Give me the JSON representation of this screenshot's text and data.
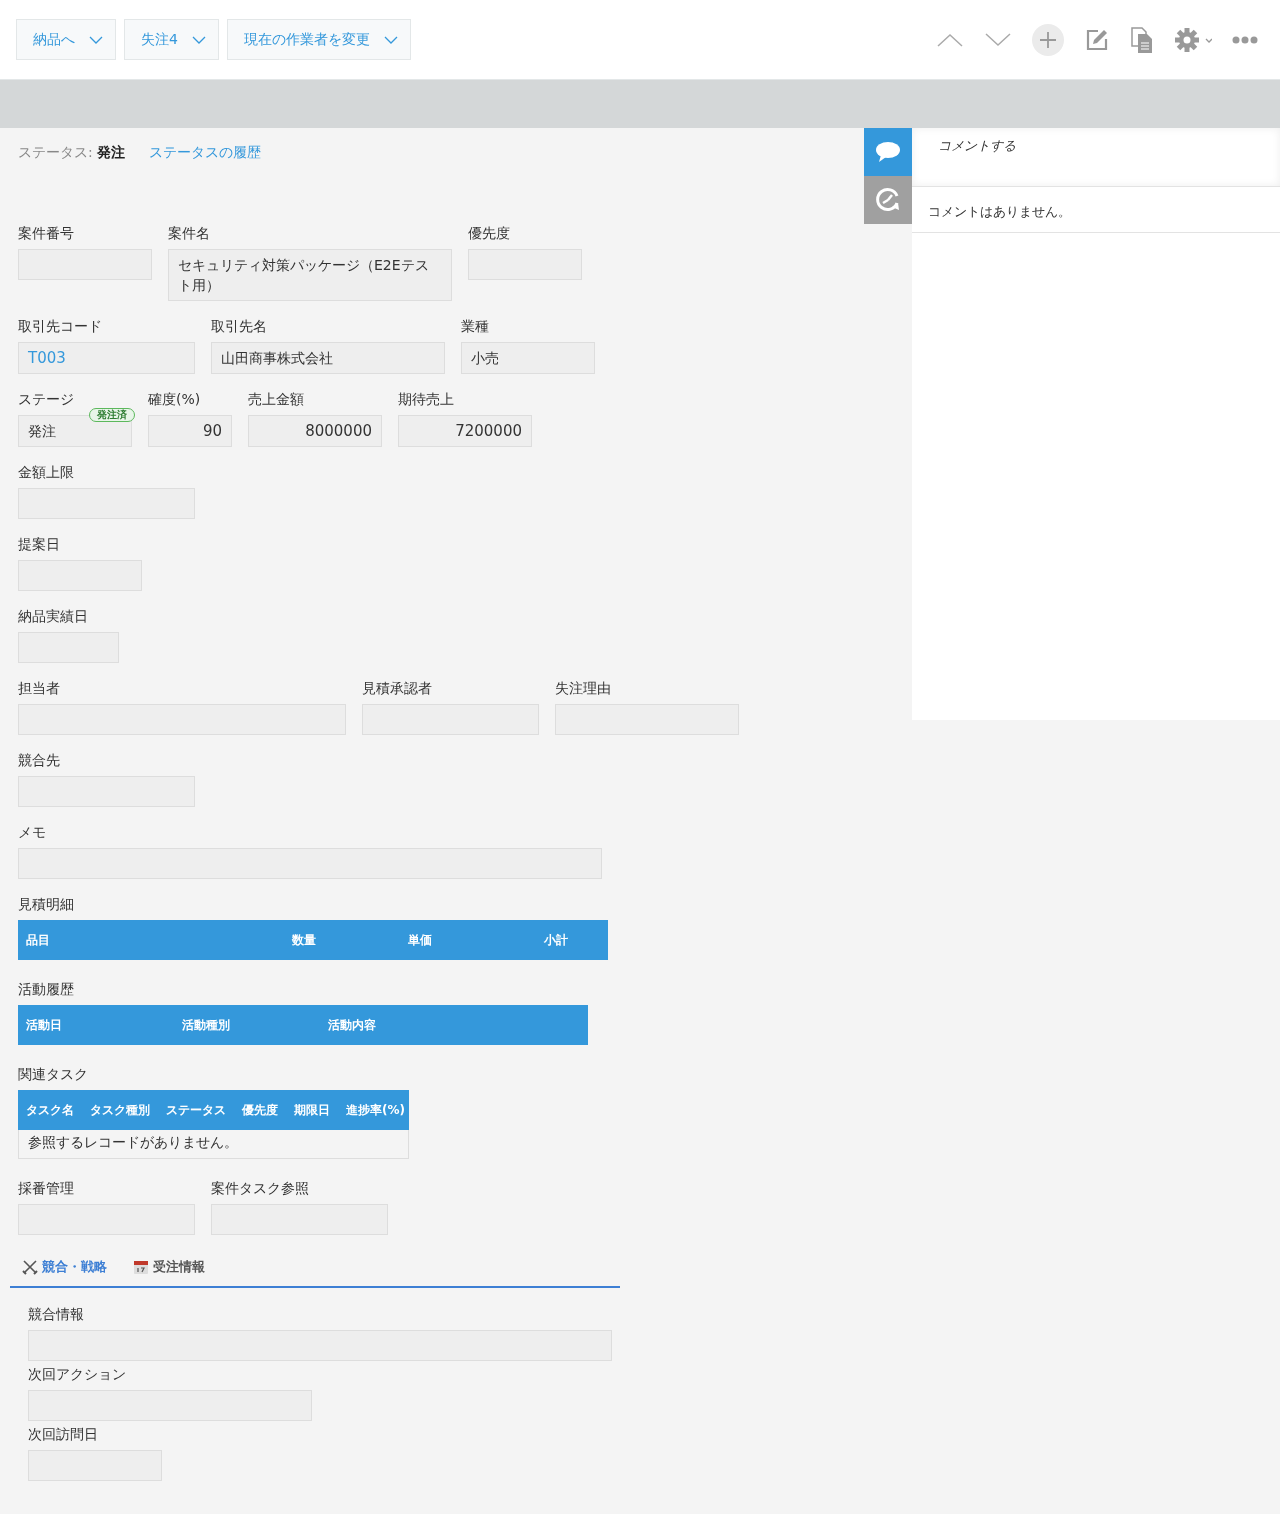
{
  "toolbar": {
    "buttons": [
      {
        "label": "納品へ"
      },
      {
        "label": "失注4"
      },
      {
        "label": "現在の作業者を変更"
      }
    ]
  },
  "status": {
    "label": "ステータス:",
    "value": "発注",
    "history_link": "ステータスの履歴"
  },
  "form": [
    {
      "kind": "fields",
      "fields": [
        {
          "label": "案件番号"
        },
        {
          "label": "案件名",
          "value": "セキュリティ対策パッケージ（E2Eテスト用）",
          "kind": "text"
        },
        {
          "label": "優先度"
        }
      ]
    },
    {
      "kind": "fields",
      "fields": [
        {
          "label": "取引先コード",
          "value": "T003",
          "kind": "link"
        },
        {
          "label": "取引先名",
          "value": "山田商事株式会社",
          "kind": "text"
        },
        {
          "label": "業種",
          "value": "小売",
          "kind": "text"
        }
      ]
    },
    {
      "kind": "fields",
      "fields": [
        {
          "label": "ステージ",
          "value": "発注",
          "kind": "text",
          "badge": "発注済"
        },
        {
          "label": "確度(%)",
          "value": "90",
          "kind": "number"
        },
        {
          "label": "売上金額",
          "value": "8000000",
          "kind": "number"
        },
        {
          "label": "期待売上",
          "value": "7200000",
          "kind": "number"
        }
      ]
    },
    {
      "kind": "fields",
      "fields": [
        {
          "label": "金額上限"
        }
      ]
    },
    {
      "kind": "fields",
      "fields": [
        {
          "label": "提案日"
        }
      ]
    },
    {
      "kind": "fields",
      "fields": [
        {
          "label": "納品実績日"
        }
      ]
    },
    {
      "kind": "fields",
      "fields": [
        {
          "label": "担当者"
        },
        {
          "label": "見積承認者"
        },
        {
          "label": "失注理由"
        }
      ]
    },
    {
      "kind": "fields",
      "fields": [
        {
          "label": "競合先"
        }
      ]
    },
    {
      "kind": "fields",
      "fields": [
        {
          "label": "メモ"
        }
      ]
    },
    {
      "kind": "table",
      "label": "見積明細",
      "columns": [
        "品目",
        "数量",
        "単価",
        "小計"
      ]
    },
    {
      "kind": "table",
      "label": "活動履歴",
      "columns": [
        "活動日",
        "活動種別",
        "活動内容"
      ]
    },
    {
      "kind": "table",
      "label": "関連タスク",
      "columns": [
        "タスク名",
        "タスク種別",
        "ステータス",
        "優先度",
        "期限日",
        "進捗率(%)"
      ],
      "empty_message": "参照するレコードがありません。"
    },
    {
      "kind": "fields",
      "fields": [
        {
          "label": "採番管理"
        },
        {
          "label": "案件タスク参照"
        }
      ]
    }
  ],
  "tabs": [
    {
      "label": "競合・戦略",
      "selected": true
    },
    {
      "label": "受注情報",
      "selected": false
    }
  ],
  "group_fields": [
    {
      "label": "競合情報"
    },
    {
      "label": "次回アクション"
    },
    {
      "label": "次回訪問日"
    }
  ],
  "side_tabs": [
    {
      "selected": true
    },
    {
      "selected": false
    }
  ],
  "comments": {
    "placeholder": "コメントする",
    "empty_message": "コメントはありません。"
  }
}
